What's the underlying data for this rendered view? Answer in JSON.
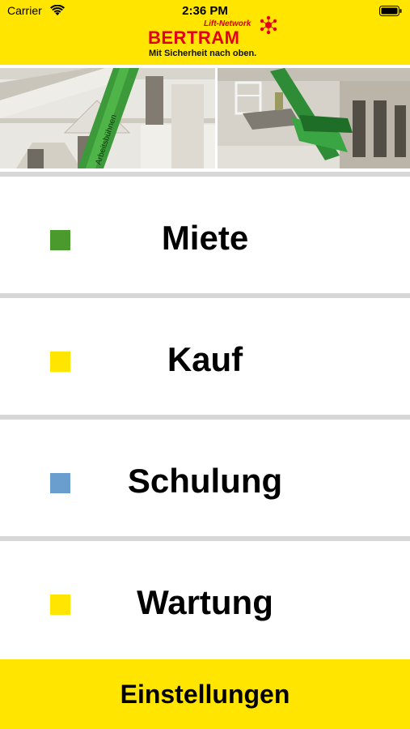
{
  "status_bar": {
    "carrier": "Carrier",
    "time": "2:36 PM"
  },
  "header": {
    "logo_network": "Lift-Network",
    "logo_brand": "BERTRAM",
    "logo_slogan": "Mit Sicherheit nach oben."
  },
  "banner": {
    "machine_text": "Arbeitsbühnen"
  },
  "menu": {
    "items": [
      {
        "label": "Miete",
        "color": "#4a9a2e"
      },
      {
        "label": "Kauf",
        "color": "#ffe500"
      },
      {
        "label": "Schulung",
        "color": "#6a9ecf"
      },
      {
        "label": "Wartung",
        "color": "#ffe500"
      }
    ]
  },
  "footer": {
    "settings_label": "Einstellungen"
  },
  "colors": {
    "brand_yellow": "#ffe500",
    "brand_red": "#e2001a"
  }
}
